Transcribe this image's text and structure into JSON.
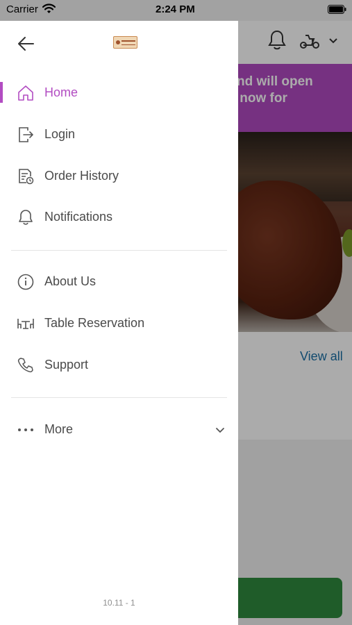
{
  "status_bar": {
    "carrier": "Carrier",
    "time": "2:24 PM"
  },
  "drawer": {
    "back_icon": "arrow-left-icon",
    "menu_primary": [
      {
        "label": "Home",
        "icon": "home-icon",
        "active": true
      },
      {
        "label": "Login",
        "icon": "login-icon",
        "active": false
      },
      {
        "label": "Order History",
        "icon": "order-history-icon",
        "active": false
      },
      {
        "label": "Notifications",
        "icon": "bell-icon",
        "active": false
      }
    ],
    "menu_secondary": [
      {
        "label": "About Us",
        "icon": "info-icon"
      },
      {
        "label": "Table Reservation",
        "icon": "table-icon"
      },
      {
        "label": "Support",
        "icon": "phone-icon"
      }
    ],
    "more": {
      "label": "More",
      "icon": "ellipsis-icon"
    },
    "version": "10.11 - 1"
  },
  "background": {
    "banner_text_1": "ed and will open",
    "banner_text_2": "rder now for",
    "view_all_label": "View all"
  },
  "colors": {
    "accent": "#b24cc2",
    "banner": "#b04ac0",
    "link": "#1a6fa5",
    "cta": "#2f8a3e"
  }
}
